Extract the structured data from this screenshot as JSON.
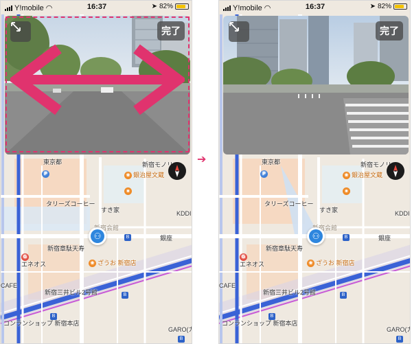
{
  "status_bar": {
    "carrier": "Y!mobile",
    "time": "16:37",
    "battery": "82%",
    "battery_fill": 0.82
  },
  "street_view": {
    "done_label": "完了",
    "expand_icon": "expand-diagonal-icon"
  },
  "map": {
    "labels": {
      "station": "新宿モノリス",
      "bank": "東京都",
      "tullys": "タリーズコーヒー",
      "sukiya": "すき家",
      "ginza": "銀治屋文蔵",
      "kddi": "KDDI",
      "shinjuku_post": "新宿章駄天寿",
      "eneos": "エネオス",
      "zauo": "ざうお 新宿店",
      "mitsui": "新宿三井ビル2号館",
      "convenience": "コンランショップ 新宿本店",
      "cafe": "CAFE",
      "garo": "GARO(カフ",
      "ginzan": "銀座",
      "note": "新宿",
      "kaikan": "新宿会館"
    }
  },
  "colors": {
    "highlight": "#e0336e",
    "location_blue": "#2e86de",
    "rail_blue": "#3a62d6",
    "rail_magenta": "#c85ad6"
  }
}
